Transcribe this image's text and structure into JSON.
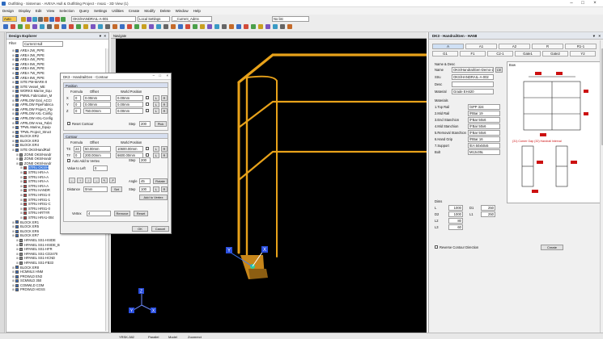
{
  "window": {
    "title": "Outfitting - Sistemas - AVEVA Hull & Outfitting Project - msa1 - 3D View (1)"
  },
  "menu": [
    "Design",
    "Display",
    "Edit",
    "View",
    "Selection",
    "Query",
    "Settings",
    "Utilities",
    "Create",
    "Modify",
    "Delete",
    "Window",
    "Help"
  ],
  "toolbar": {
    "mode": "Auto",
    "element_field": "OKS/HANDRAIL-A-001",
    "settings_field": "Local Settings",
    "current_field": "__Current_Admn",
    "list_field": "No list"
  },
  "explorer": {
    "title": "Design Explorer",
    "filter_label": "Filter",
    "filter_value": "Current Hull",
    "items": [
      {
        "t": "AREA 2W_PIPE",
        "d": 1
      },
      {
        "t": "AREA 3W_PIPE",
        "d": 1
      },
      {
        "t": "AREA 4W_PIPE",
        "d": 1
      },
      {
        "t": "AREA 5W_PIPE",
        "d": 1
      },
      {
        "t": "AREA 6W_PIPE",
        "d": 1
      },
      {
        "t": "AREA 7W_PIPE",
        "d": 1
      },
      {
        "t": "AREA 8W_PIPE",
        "d": 1
      },
      {
        "t": "SITE PM-MARK-0",
        "d": 1
      },
      {
        "t": "SITE Vessel_ME",
        "d": 1
      },
      {
        "t": "WORKS Marine_Equ",
        "d": 1
      },
      {
        "t": "PMWL Fabrication_M",
        "d": 1
      },
      {
        "t": "APRLOW Gral_ACCI",
        "d": 1
      },
      {
        "t": "APRLOW PipeFabrica",
        "d": 1
      },
      {
        "t": "APRLOW Project_Pip",
        "d": 1
      },
      {
        "t": "APRLOW AXL-Config",
        "d": 1
      },
      {
        "t": "APRLOW HXL-Config",
        "d": 1
      },
      {
        "t": "APRLOW Area_Fabri",
        "d": 1
      },
      {
        "t": "TPWL Marine_Equip",
        "d": 1
      },
      {
        "t": "TPWL Project_Struct",
        "d": 1
      },
      {
        "t": "BLOCK ER2",
        "d": 1
      },
      {
        "t": "BLOCK ER3",
        "d": 1
      },
      {
        "t": "BLOCK ER4",
        "d": 1
      },
      {
        "t": "SITE OKS/HandRail",
        "d": 1
      },
      {
        "t": "ZONE OKS/Handr",
        "d": 2
      },
      {
        "t": "ZONE OKS/Handr",
        "d": 2
      },
      {
        "t": "ZONE OKS/Handr",
        "d": 2
      },
      {
        "t": "STRU OKS/H",
        "d": 3,
        "sel": true
      },
      {
        "t": "STRU HRA-A",
        "d": 3
      },
      {
        "t": "STRU HRA-A",
        "d": 3
      },
      {
        "t": "STRU HRA-A",
        "d": 3
      },
      {
        "t": "STRU HRA-A",
        "d": 3
      },
      {
        "t": "STRU HANDR",
        "d": 3
      },
      {
        "t": "STRU HRS1-0",
        "d": 3
      },
      {
        "t": "STRU HRS1-1",
        "d": 3
      },
      {
        "t": "STRU HRS1-C",
        "d": 3
      },
      {
        "t": "STRU HRS1-0",
        "d": 3
      },
      {
        "t": "STRU HRTYR",
        "d": 3
      },
      {
        "t": "STRU HRA1-004",
        "d": 3
      },
      {
        "t": "BLOCK ER1",
        "d": 1
      },
      {
        "t": "BLOCK ER5",
        "d": 1
      },
      {
        "t": "BLOCK ER6",
        "d": 1
      },
      {
        "t": "BLOCK ER7",
        "d": 1
      },
      {
        "t": "HPANEL SS1-HSIDE",
        "d": 2
      },
      {
        "t": "HPANEL SS1-HSIDE_B",
        "d": 2
      },
      {
        "t": "HPANEL SS1-HFR",
        "d": 2
      },
      {
        "t": "HPANEL SS1-CD2470",
        "d": 2
      },
      {
        "t": "HPANEL SS1-HCND",
        "d": 2
      },
      {
        "t": "HPANEL SS1-FB33",
        "d": 2
      },
      {
        "t": "BLOCK ER8",
        "d": 1
      },
      {
        "t": "HCMMLS HNM",
        "d": 1
      },
      {
        "t": "PROWLD EN3",
        "d": 1
      },
      {
        "t": "SCMWLD 350",
        "d": 1
      },
      {
        "t": "COMWLD COM",
        "d": 1
      },
      {
        "t": "PROWLD HGSS",
        "d": 1
      }
    ]
  },
  "view": {
    "label": "Navigate",
    "axis_x": "X",
    "axis_y": "Y",
    "axis_z": "Z"
  },
  "dialog": {
    "title": "DK3 - HandrailGen - Contour",
    "position_group": "Position",
    "hdr_formula": "Formula",
    "hdr_offset": "Offset",
    "hdr_world": "World Position",
    "pos_rows": [
      {
        "axis": "X",
        "formula": "0",
        "offset": "0.00mm",
        "world": "0.00mm"
      },
      {
        "axis": "Y",
        "formula": "0",
        "offset": "0.00mm",
        "world": "0.00mm"
      },
      {
        "axis": "Z",
        "formula": "0",
        "offset": "750.00mm",
        "world": "0.00mm"
      }
    ],
    "reset_contour": "Reset Contour",
    "step_label": "Step",
    "step_value": "200",
    "pick": "Pick",
    "contour_group": "Contour",
    "con_rows": [
      {
        "axis": "TX",
        "formula": "24",
        "offset": "50.00mm",
        "world": "10600.00mm"
      },
      {
        "axis": "TY",
        "formula": "0",
        "offset": "200.00mm",
        "world": "6600.00mm"
      }
    ],
    "auto_add": "Auto Add to Vertex",
    "value_label": "Value to Left",
    "value": "0",
    "distance_label": "Distance",
    "distance_value": "0mm",
    "set_btn": "Set",
    "angle_label": "Angle",
    "angle_value": "45",
    "rotate_btn": "Rotate",
    "step2_label": "Step",
    "step2_value": "100",
    "add_vertex_btn": "Add to Vertex",
    "vertex_label": "Vertex",
    "vertex_value": "4",
    "remove_btn": "Remove",
    "reset_btn": "Reset",
    "ok_btn": "OK",
    "cancel_btn": "Cancel",
    "lbl_L": "L",
    "lbl_R": "R"
  },
  "props": {
    "title": "DK3 - HandrailGen - HA58",
    "tabs_row1": [
      "A",
      "A1",
      "A2",
      "R",
      "R1-1"
    ],
    "tabs_row2": [
      "G1",
      "F1",
      "C2-1",
      "Gate1",
      "Gate2",
      "Y2"
    ],
    "name_desc": "Name & Desc",
    "rows": [
      {
        "label": "Name",
        "value": "OKS/HandrailGen-Demo-2"
      },
      {
        "label": "Stru",
        "value": "OKS/HANDRAIL-A-002"
      },
      {
        "label": "Desc",
        "value": ""
      },
      {
        "label": "Material",
        "value": "Grade EH420"
      }
    ],
    "ce_btn": "CE",
    "materials_label": "Materials",
    "materials": [
      {
        "label": "1.Top Rail",
        "value": "/SPP 324"
      },
      {
        "label": "2.Mid Rail",
        "value": "/RBar 19"
      },
      {
        "label": "3.End Stanchion",
        "value": "/FBar 50x6"
      },
      {
        "label": "4.Mid Stanchion",
        "value": "/FBar 50x6"
      },
      {
        "label": "5.Removal Stanchion",
        "value": "/FBar 50x6"
      },
      {
        "label": "6.Hand Grip",
        "value": "/RBar 16"
      },
      {
        "label": "7.Support",
        "value": "/EA 50x50x5"
      },
      {
        "label": "Bolt",
        "value": "M12x35L"
      }
    ],
    "preview_label": "Bow",
    "preview_caption": "(31) Corner Gap    (32) Handrail Interval",
    "dims_label": "Dims",
    "dims": [
      {
        "label": "L",
        "value": "1000",
        "label2": "D1",
        "value2": "250"
      },
      {
        "label": "D2",
        "value": "1000",
        "label2": "L1",
        "value2": "250"
      },
      {
        "label": "L2",
        "value": "80",
        "label2": "",
        "value2": ""
      },
      {
        "label": "L3",
        "value": "60",
        "label2": "",
        "value2": ""
      }
    ],
    "reverse_label": "Reverse Contour Direction",
    "create_btn": "Create"
  },
  "status": {
    "coord": "YRSK-382",
    "mode": "Parallel",
    "model": "Model",
    "zoom": "Zoomrect"
  },
  "colors": {
    "rail": "#e8a21a",
    "selection": "#3b78d8"
  }
}
